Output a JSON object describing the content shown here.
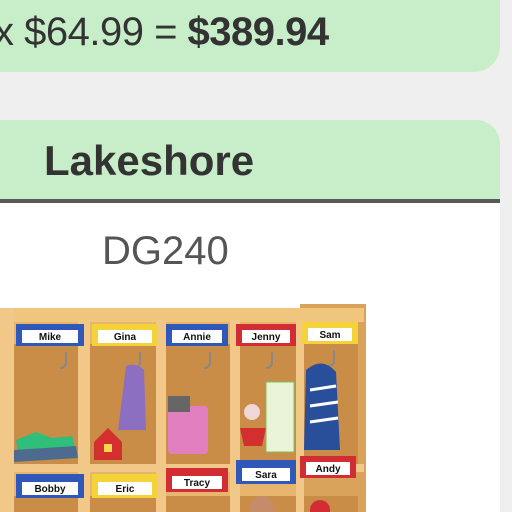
{
  "price_line": {
    "prefix": "x $64.99 = ",
    "total": "$389.94"
  },
  "product": {
    "brand": "Lakeshore",
    "sku": "DG240",
    "image_labels": [
      "Mike",
      "Gina",
      "Annie",
      "Jenny",
      "Sam",
      "Bobby",
      "Eric",
      "Tracy",
      "Sara",
      "Andy"
    ],
    "bin_colors": {
      "blue": "#2f58b8",
      "yellow": "#f3d23a",
      "red": "#d22c34"
    }
  }
}
